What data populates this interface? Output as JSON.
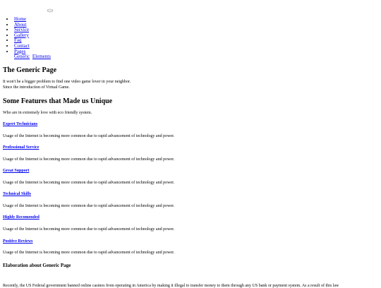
{
  "logo": {
    "alt": ""
  },
  "nav": {
    "items": [
      "Home",
      "About",
      "Service",
      "Gallery",
      "Faq",
      "Contact",
      "Pages"
    ],
    "sub_items": [
      "Generic",
      "Elements"
    ]
  },
  "generic": {
    "title": "The Generic Page",
    "intro": "It won't be a bigger problem to find one video game lover in your neighbor. Since the introduction of Virtual Game."
  },
  "features": {
    "title": "Some Features that Made us Unique",
    "subtitle": "Who are in extremely love with eco friendly system.",
    "items": [
      {
        "title": "Expert Technicians",
        "desc": "Usage of the Internet is becoming more common due to rapid advancement of technology and power."
      },
      {
        "title": "Professional Service",
        "desc": "Usage of the Internet is becoming more common due to rapid advancement of technology and power."
      },
      {
        "title": "Great Support",
        "desc": "Usage of the Internet is becoming more common due to rapid advancement of technology and power."
      },
      {
        "title": "Technical Skills",
        "desc": "Usage of the Internet is becoming more common due to rapid advancement of technology and power."
      },
      {
        "title": "Highly Recomended",
        "desc": "Usage of the Internet is becoming more common due to rapid advancement of technology and power."
      },
      {
        "title": "Positive Reviews",
        "desc": "Usage of the Internet is becoming more common due to rapid advancement of technology and power."
      }
    ]
  },
  "elaboration": {
    "title": "Elaboration about Generic Page",
    "text": "Recently, the US Federal government banned online casinos from operating in America by making it illegal to transfer money to them through any US bank or payment system. As a result of this law"
  }
}
